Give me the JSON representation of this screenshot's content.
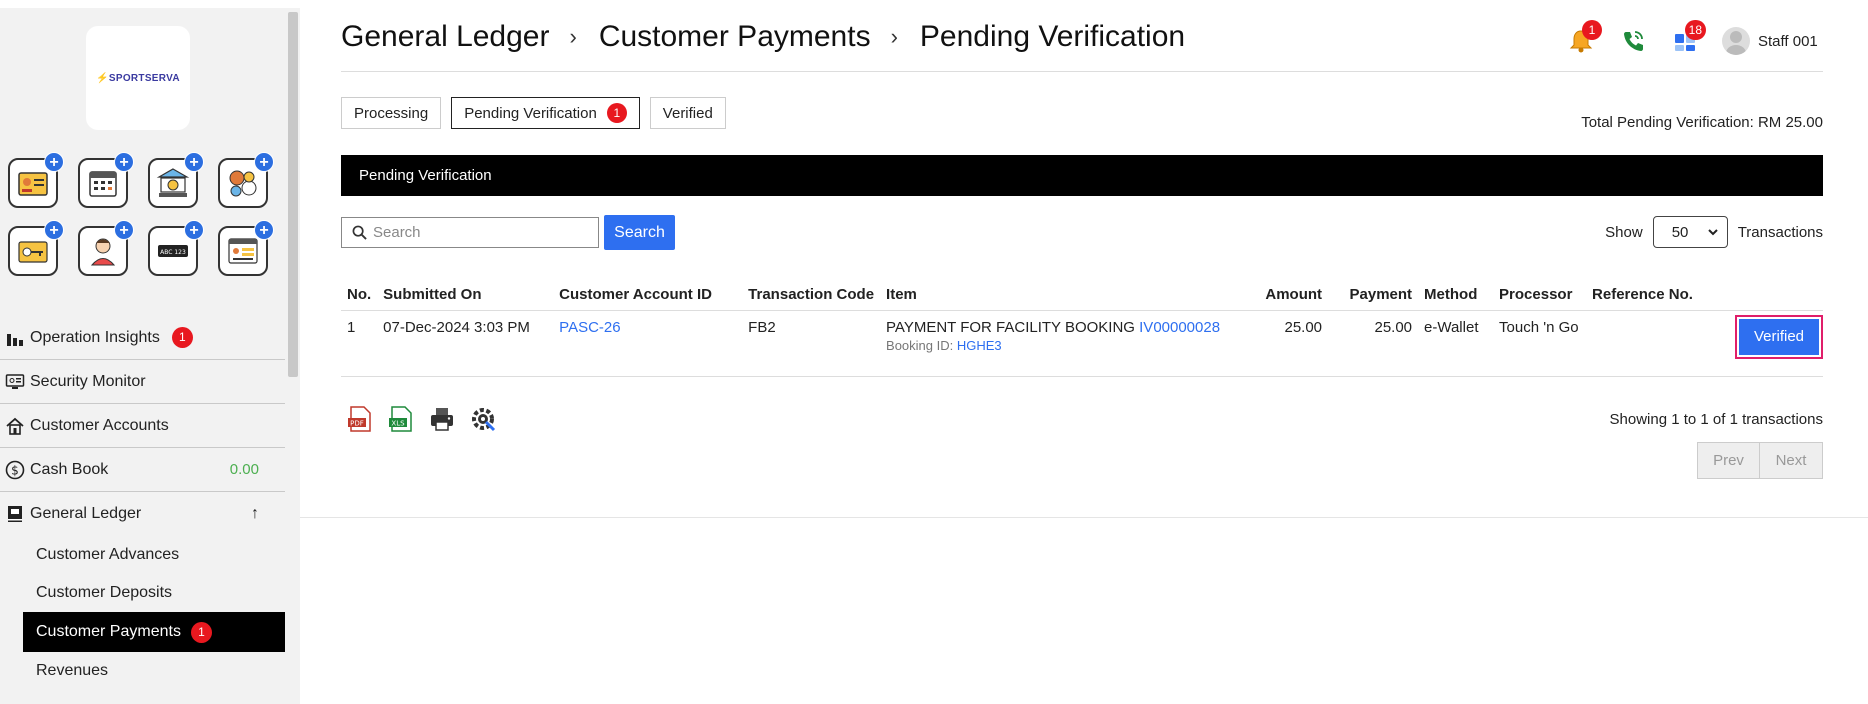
{
  "sidebar": {
    "logo_text": "SPORTSERVA",
    "quick_icons": [
      "id-card-icon",
      "calendar-icon",
      "bank-icon",
      "sports-icon",
      "key-card-icon",
      "person-icon",
      "barcode-icon",
      "login-icon"
    ],
    "nav": {
      "operation_insights": "Operation Insights",
      "operation_insights_badge": "1",
      "security_monitor": "Security Monitor",
      "customer_accounts": "Customer Accounts",
      "cash_book": "Cash Book",
      "cash_book_value": "0.00",
      "general_ledger": "General Ledger",
      "general_ledger_arrow": "↑"
    },
    "sub_nav": {
      "customer_advances": "Customer Advances",
      "customer_deposits": "Customer Deposits",
      "customer_payments": "Customer Payments",
      "customer_payments_badge": "1",
      "revenues": "Revenues"
    }
  },
  "header": {
    "crumb1": "General Ledger",
    "crumb2": "Customer Payments",
    "crumb3": "Pending Verification",
    "separator": "›",
    "notification_badge": "1",
    "tasks_badge": "18",
    "user_name": "Staff 001"
  },
  "tabs": {
    "processing": "Processing",
    "pending": "Pending Verification",
    "pending_badge": "1",
    "verified": "Verified"
  },
  "total_pending": "Total Pending Verification: RM 25.00",
  "section_title": "Pending Verification",
  "search": {
    "placeholder": "Search",
    "value": "",
    "button": "Search"
  },
  "show": {
    "label": "Show",
    "selected": "50",
    "suffix": "Transactions"
  },
  "table": {
    "headers": {
      "no": "No.",
      "submitted_on": "Submitted On",
      "customer_account_id": "Customer Account ID",
      "transaction_code": "Transaction Code",
      "item": "Item",
      "amount": "Amount",
      "payment": "Payment",
      "method": "Method",
      "processor": "Processor",
      "reference_no": "Reference No."
    },
    "rows": [
      {
        "no": "1",
        "submitted_on": "07-Dec-2024 3:03 PM",
        "customer_account_id": "PASC-26",
        "transaction_code": "FB2",
        "item_text": "PAYMENT FOR FACILITY BOOKING",
        "item_invoice": "IV00000028",
        "booking_label": "Booking ID:",
        "booking_id": "HGHE3",
        "amount": "25.00",
        "payment": "25.00",
        "method": "e-Wallet",
        "processor": "Touch 'n Go",
        "reference_no": "",
        "action": "Verified"
      }
    ]
  },
  "footer": {
    "showing": "Showing 1 to 1 of 1 transactions",
    "prev": "Prev",
    "next": "Next",
    "export_icons": [
      "pdf-icon",
      "xls-icon",
      "print-icon",
      "settings-icon"
    ]
  },
  "colors": {
    "accent": "#2e6ff0",
    "badge": "#e8181f",
    "section_bar": "#000000",
    "cash_value": "#4caf50",
    "highlight_outline": "#e01e6a"
  }
}
